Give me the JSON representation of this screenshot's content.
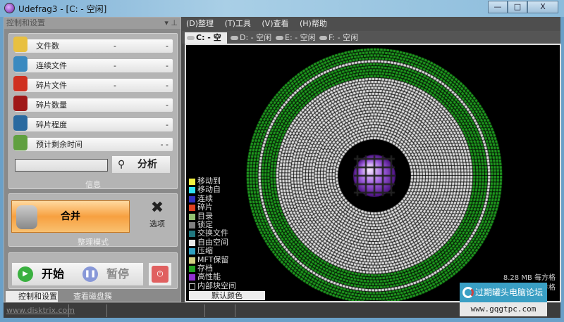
{
  "window": {
    "title": "Udefrag3 - [C: - 空闲]",
    "minimize": "—",
    "maximize": "□",
    "close": "X"
  },
  "left_panel": {
    "header": "控制和设置",
    "pin": "▾ ⊥",
    "stats": [
      {
        "label": "文件数",
        "v1": "-",
        "v2": "-",
        "icon": "folder-icon",
        "color": "#e8c040"
      },
      {
        "label": "连续文件",
        "v1": "-",
        "v2": "-",
        "icon": "contiguous-files-icon",
        "color": "#3a8ac0"
      },
      {
        "label": "碎片文件",
        "v1": "-",
        "v2": "-",
        "icon": "fragmented-files-icon",
        "color": "#d03020"
      },
      {
        "label": "碎片数量",
        "v1": "",
        "v2": "-",
        "icon": "fragments-count-icon",
        "color": "#a01818"
      },
      {
        "label": "碎片程度",
        "v1": "",
        "v2": "-",
        "icon": "fragmentation-level-icon",
        "color": "#2a6aa0"
      },
      {
        "label": "预计剩余时间",
        "v1": "",
        "v2": "- -",
        "icon": "stopwatch-icon",
        "color": "#60a040"
      }
    ],
    "info_value": "",
    "analyze_label": "分析",
    "info_group": "信息",
    "merge_label": "合并",
    "options_label": "选项",
    "mode_group": "整理模式",
    "start_label": "开始",
    "pause_label": "暂停"
  },
  "bottom_tabs": [
    "控制和设置",
    "查看磁盘簇"
  ],
  "status": {
    "url": "www.disktrix.com"
  },
  "menu": [
    "(D)整理",
    "(T)工具",
    "(V)查看",
    "(H)帮助"
  ],
  "drive_tabs": [
    "C: - 空闲",
    "D: - 空闲",
    "E: - 空闲",
    "F: - 空闲"
  ],
  "legend": [
    {
      "label": "移动到",
      "color": "#f0f040"
    },
    {
      "label": "移动自",
      "color": "#30e0f0"
    },
    {
      "label": "连续",
      "color": "#3030c0"
    },
    {
      "label": "碎片",
      "color": "#e04020"
    },
    {
      "label": "目录",
      "color": "#90c070"
    },
    {
      "label": "锁定",
      "color": "#808080"
    },
    {
      "label": "交换文件",
      "color": "#207880"
    },
    {
      "label": "自由空间",
      "color": "#e8e8e8"
    },
    {
      "label": "压缩",
      "color": "#30a0c0"
    },
    {
      "label": "MFT保留",
      "color": "#d0d080"
    },
    {
      "label": "存档",
      "color": "#20a020"
    },
    {
      "label": "高性能",
      "color": "#9030d0"
    },
    {
      "label": "内部块空间",
      "color": "#000000"
    }
  ],
  "default_colors": "默认颜色",
  "scale": {
    "mb": "8.28 MB 每方格",
    "clusters": "2118 簇每方格"
  },
  "watermark": {
    "name": "过期罐头电脑论坛",
    "url": "www.gqgtpc.com"
  }
}
